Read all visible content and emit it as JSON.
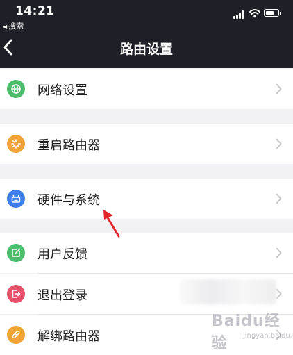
{
  "status_bar": {
    "time": "14:21",
    "back_app": "搜索"
  },
  "header": {
    "title": "路由设置"
  },
  "menu": [
    {
      "label": "网络设置",
      "icon": "globe-icon",
      "color": "#4cbd6a"
    },
    {
      "label": "重启路由器",
      "icon": "loading-spinner-icon",
      "color": "#f0a436"
    },
    {
      "label": "硬件与系统",
      "icon": "router-icon",
      "color": "#3f7ee8"
    },
    {
      "label": "用户反馈",
      "icon": "edit-feedback-icon",
      "color": "#4cbd6a"
    },
    {
      "label": "退出登录",
      "icon": "logout-icon",
      "color": "#e9506a"
    },
    {
      "label": "解绑路由器",
      "icon": "unlink-icon",
      "color": "#f0a436"
    }
  ],
  "watermark": {
    "brand": "Baidu经验",
    "url": "jingyan.baidu.com"
  },
  "colors": {
    "header_bg": "#1f1f27",
    "page_bg": "#f2f2f4",
    "annotation_arrow": "#e0262b"
  }
}
